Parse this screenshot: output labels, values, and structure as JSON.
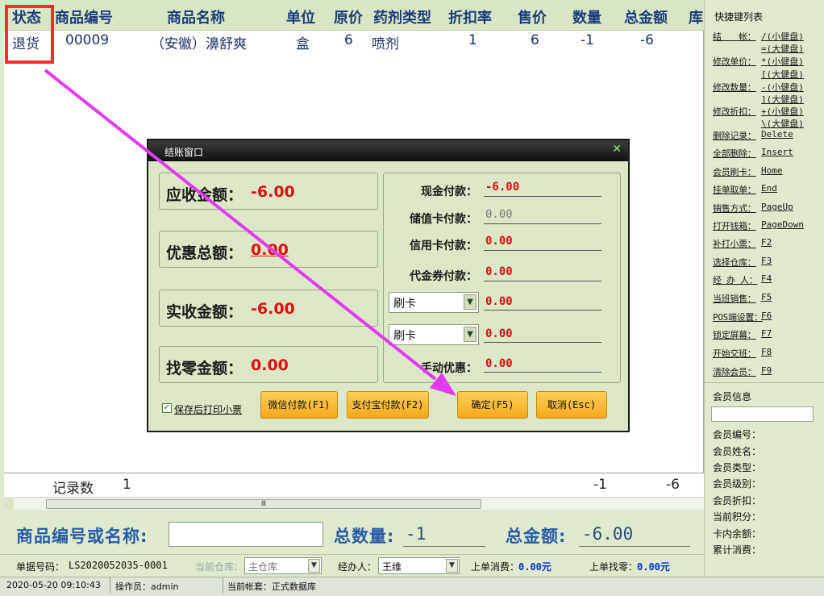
{
  "grid": {
    "columns": [
      "状态",
      "商品编号",
      "商品名称",
      "单位",
      "原价",
      "药剂类型",
      "折扣率",
      "售价",
      "数量",
      "总金额",
      "库"
    ],
    "rows": [
      {
        "status": "退货",
        "code": "00009",
        "name": "（安徽）濞舒爽",
        "unit": "盒",
        "orig_price": "6",
        "type": "喷剂",
        "discount": "1",
        "price": "6",
        "qty": "-1",
        "total": "-6"
      }
    ],
    "footer": {
      "label": "记录数",
      "count": "1",
      "qty": "-1",
      "total": "-6"
    },
    "scroll_glyph": "Ⅲ"
  },
  "shortcuts": {
    "title": "快捷键列表",
    "items": [
      {
        "l": "结　　帐：",
        "r": "/(小健盘)"
      },
      {
        "l": "",
        "r": "=(大健盘)"
      },
      {
        "l": "修改单价：",
        "r": "*(小健盘)"
      },
      {
        "l": "",
        "r": "[(大健盘)"
      },
      {
        "l": "修改数量：",
        "r": "-(小健盘)"
      },
      {
        "l": "",
        "r": "](大健盘)"
      },
      {
        "l": "修改折扣：",
        "r": "+(小健盘)"
      },
      {
        "l": "",
        "r": "\\(大健盘)"
      },
      {
        "l": "删除记录：",
        "r": "Delete"
      },
      {
        "l": "全部删除：",
        "r": "Insert"
      },
      {
        "l": "会员刷卡：",
        "r": "Home"
      },
      {
        "l": "挂单取单：",
        "r": "End"
      },
      {
        "l": "销售方式：",
        "r": "PageUp"
      },
      {
        "l": "打开钱箱：",
        "r": "PageDown"
      },
      {
        "l": "补打小票：",
        "r": "F2"
      },
      {
        "l": "选择仓库：",
        "r": "F3"
      },
      {
        "l": "经 办 人：",
        "r": "F4"
      },
      {
        "l": "当班销售：",
        "r": "F5"
      },
      {
        "l": "POS端设置：",
        "r": "F6"
      },
      {
        "l": "锁定屏幕：",
        "r": "F7"
      },
      {
        "l": "开始交班：",
        "r": "F8"
      },
      {
        "l": "清除会员：",
        "r": "F9"
      }
    ]
  },
  "member": {
    "title": "会员信息",
    "fields": [
      "会员编号：",
      "会员姓名：",
      "会员类型：",
      "会员级别：",
      "会员折扣：",
      "当前积分：",
      "卡内余额：",
      "累计消费："
    ]
  },
  "bottom": {
    "search_label": "商品编号或名称:",
    "qty_label": "总数量:",
    "qty_value": "-1",
    "amount_label": "总金额:",
    "amount_value": "-6.00",
    "doc_label": "单据号码：",
    "doc_value": "LS2020052035-0001",
    "warehouse_label": "当前仓库：",
    "warehouse_value": "主仓库",
    "handler_label": "经办人：",
    "handler_value": "王维",
    "last_consume_label": "上单消费：",
    "last_consume_value": "0.00元",
    "last_change_label": "上单找零：",
    "last_change_value": "0.00元"
  },
  "statusbar": {
    "datetime": "2020-05-20 09:10:43",
    "operator": "操作员：admin",
    "account": "当前帐套：正式数据库"
  },
  "dialog": {
    "title": "结账窗口",
    "receivable_label": "应收金额：",
    "receivable_value": "-6.00",
    "discount_label": "优惠总额：",
    "discount_value": "0.00",
    "received_label": "实收金额：",
    "received_value": "-6.00",
    "change_label": "找零金额：",
    "change_value": "0.00",
    "cash_label": "现金付款：",
    "cash_value": "-6.00",
    "stored_label": "储值卡付款：",
    "stored_value": "0.00",
    "credit_label": "信用卡付款：",
    "credit_value": "0.00",
    "voucher_label": "代金券付款：",
    "voucher_value": "0.00",
    "combo1_value": "刷卡",
    "combo1_amount": "0.00",
    "combo2_value": "刷卡",
    "combo2_amount": "0.00",
    "manual_label": "手动优惠：",
    "manual_value": "0.00",
    "print_label": "保存后打印小票",
    "btn_wechat": "微信付款(F1)",
    "btn_alipay": "支付宝付款(F2)",
    "btn_ok": "确定(F5)",
    "btn_cancel": "取消(Esc)",
    "close_glyph": "✕"
  },
  "colors": {
    "annotation": "#ff2a2a",
    "arrow": "#e23bf2",
    "amount_red": "#e01010",
    "accent_blue": "#2a5ca6"
  }
}
